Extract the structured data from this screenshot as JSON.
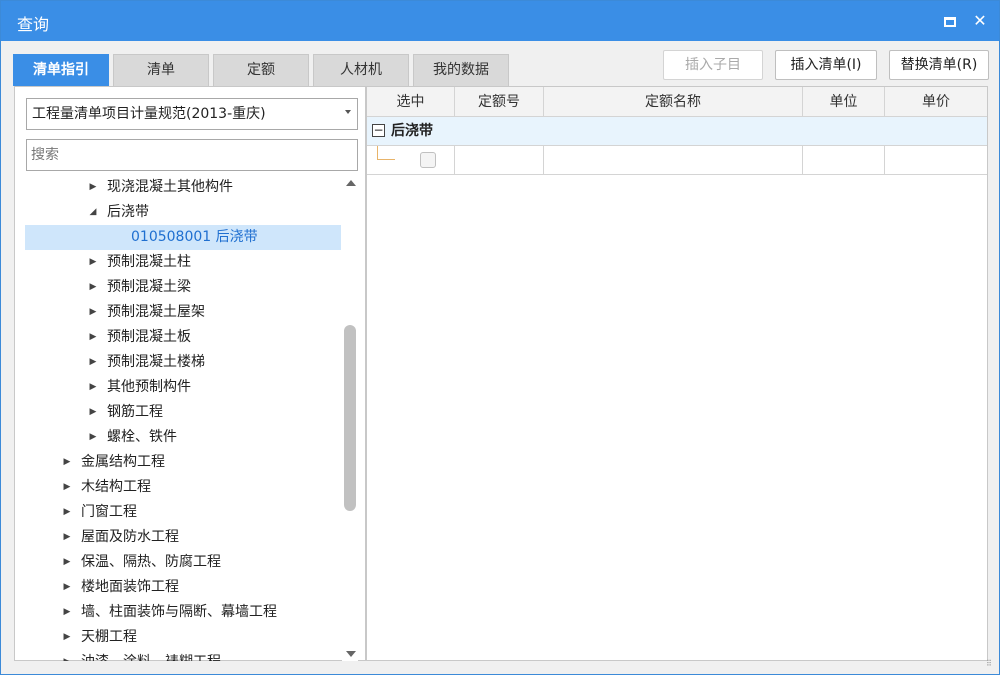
{
  "window": {
    "title": "查询",
    "maximize_icon": "maximize-icon",
    "close_icon": "close-icon",
    "close_glyph": "✕"
  },
  "tabs": [
    {
      "label": "清单指引",
      "active": true
    },
    {
      "label": "清单",
      "active": false
    },
    {
      "label": "定额",
      "active": false
    },
    {
      "label": "人材机",
      "active": false
    },
    {
      "label": "我的数据",
      "active": false
    }
  ],
  "actions": {
    "insert_child": "插入子目",
    "insert_list": "插入清单(I)",
    "replace_list": "替换清单(R)"
  },
  "left": {
    "spec_select": "工程量清单项目计量规范(2013-重庆)",
    "search_placeholder": "搜索",
    "tree": [
      {
        "label": "现浇混凝土其他构件",
        "arrow": "▶",
        "level": 2
      },
      {
        "label": "后浇带",
        "arrow": "◢",
        "level": 2
      },
      {
        "label": "010508001  后浇带",
        "arrow": "",
        "level": 3,
        "selected": true
      },
      {
        "label": "预制混凝土柱",
        "arrow": "▶",
        "level": 2
      },
      {
        "label": "预制混凝土梁",
        "arrow": "▶",
        "level": 2
      },
      {
        "label": "预制混凝土屋架",
        "arrow": "▶",
        "level": 2
      },
      {
        "label": "预制混凝土板",
        "arrow": "▶",
        "level": 2
      },
      {
        "label": "预制混凝土楼梯",
        "arrow": "▶",
        "level": 2
      },
      {
        "label": "其他预制构件",
        "arrow": "▶",
        "level": 2
      },
      {
        "label": "钢筋工程",
        "arrow": "▶",
        "level": 2
      },
      {
        "label": "螺栓、铁件",
        "arrow": "▶",
        "level": 2
      },
      {
        "label": "金属结构工程",
        "arrow": "▶",
        "level": 1
      },
      {
        "label": "木结构工程",
        "arrow": "▶",
        "level": 1
      },
      {
        "label": "门窗工程",
        "arrow": "▶",
        "level": 1
      },
      {
        "label": "屋面及防水工程",
        "arrow": "▶",
        "level": 1
      },
      {
        "label": "保温、隔热、防腐工程",
        "arrow": "▶",
        "level": 1
      },
      {
        "label": "楼地面装饰工程",
        "arrow": "▶",
        "level": 1
      },
      {
        "label": "墙、柱面装饰与隔断、幕墙工程",
        "arrow": "▶",
        "level": 1
      },
      {
        "label": "天棚工程",
        "arrow": "▶",
        "level": 1
      },
      {
        "label": "油漆、涂料、裱糊工程",
        "arrow": "▶",
        "level": 1
      }
    ]
  },
  "grid": {
    "columns": [
      "选中",
      "定额号",
      "定额名称",
      "单位",
      "单价"
    ],
    "group_label": "后浇带",
    "expander_glyph": "−",
    "rows": [
      {
        "selected": false,
        "code": "",
        "name": "",
        "unit": "",
        "price": ""
      }
    ]
  },
  "colors": {
    "accent": "#3a8ee6",
    "selection": "#cfe6fb",
    "group_row": "#e8f4fd"
  }
}
